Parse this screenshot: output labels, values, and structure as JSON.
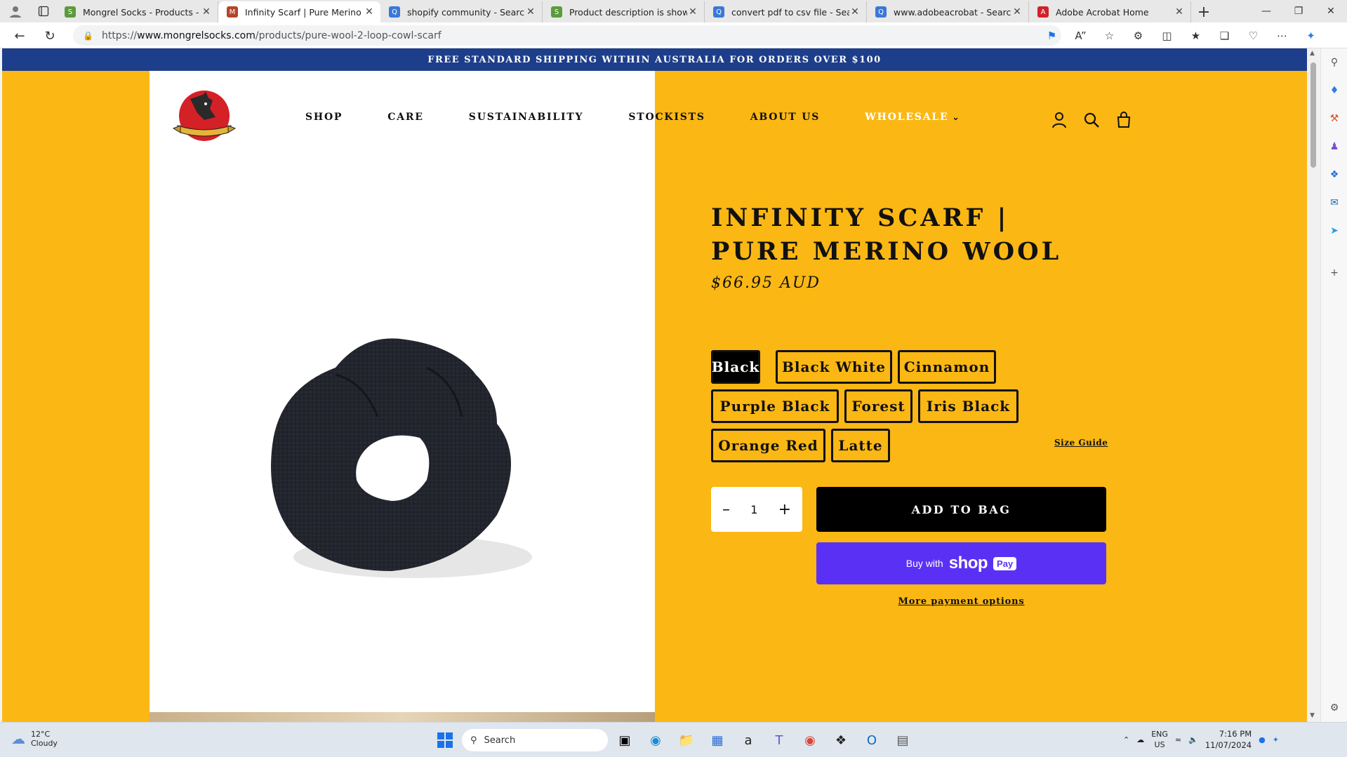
{
  "browser": {
    "tabs": [
      {
        "title": "Mongrel Socks - Products - Infini",
        "fav_color": "#5b9b3c",
        "fav_glyph": "S",
        "active": false
      },
      {
        "title": "Infinity Scarf | Pure Merino Woo",
        "fav_color": "#b5442b",
        "fav_glyph": "M",
        "active": true
      },
      {
        "title": "shopify community - Search",
        "fav_color": "#3a78d8",
        "fav_glyph": "Q",
        "active": false
      },
      {
        "title": "Product description is showing",
        "fav_color": "#5b9b3c",
        "fav_glyph": "S",
        "active": false
      },
      {
        "title": "convert pdf to csv file - Search",
        "fav_color": "#3a78d8",
        "fav_glyph": "Q",
        "active": false
      },
      {
        "title": "www.adobeacrobat - Search",
        "fav_color": "#3a78d8",
        "fav_glyph": "Q",
        "active": false
      },
      {
        "title": "Adobe Acrobat Home",
        "fav_color": "#d1232a",
        "fav_glyph": "A",
        "active": false
      }
    ],
    "url_prefix": "https://",
    "url_host": "www.mongrelsocks.com",
    "url_path": "/products/pure-wool-2-loop-cowl-scarf"
  },
  "store": {
    "announcement": "FREE STANDARD SHIPPING WITHIN AUSTRALIA FOR ORDERS OVER $100",
    "nav": {
      "shop": "SHOP",
      "care": "CARE",
      "sustainability": "SUSTAINABILITY",
      "stockists": "STOCKISTS",
      "about": "ABOUT US",
      "wholesale": "WHOLESALE"
    }
  },
  "product": {
    "title": "INFINITY SCARF | PURE MERINO WOOL",
    "price": "$66.95 AUD",
    "variants": [
      "Black",
      "Black White",
      "Cinnamon",
      "Purple Black",
      "Forest",
      "Iris Black",
      "Orange Red",
      "Latte"
    ],
    "selected_variant": "Black",
    "size_guide": "Size Guide",
    "quantity": "1",
    "add_to_bag": "ADD TO BAG",
    "shop_pay_prefix": "Buy with",
    "shop_pay_brand": "shop",
    "shop_pay_badge": "Pay",
    "more_payment": "More payment options"
  },
  "taskbar": {
    "temp": "12°C",
    "weather": "Cloudy",
    "search_placeholder": "Search",
    "lang": "ENG",
    "region": "US",
    "time": "7:16 PM",
    "date": "11/07/2024"
  },
  "colors": {
    "page_bg": "#fbb714",
    "announce_bg": "#1d3e8a",
    "shop_pay": "#5a31f4"
  }
}
